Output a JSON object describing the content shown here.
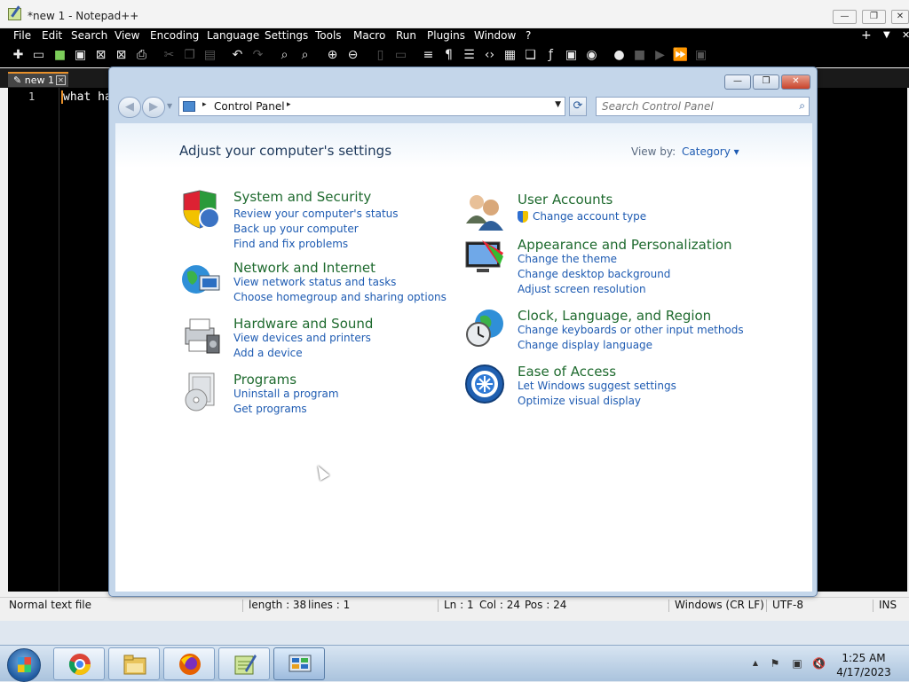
{
  "notepad": {
    "title": "*new 1 - Notepad++",
    "window_buttons": {
      "minimize": "—",
      "maximize": "❐",
      "close": "✕"
    },
    "menu": [
      "File",
      "Edit",
      "Search",
      "View",
      "Encoding",
      "Language",
      "Settings",
      "Tools",
      "Macro",
      "Run",
      "Plugins",
      "Window",
      "?"
    ],
    "menu_right": {
      "add": "+",
      "dropdown": "▼",
      "close": "✕"
    },
    "tab": {
      "label": "new 1",
      "close": "✕"
    },
    "editor": {
      "line_number": "1",
      "text": "what ha"
    },
    "status": {
      "file_type": "Normal text file",
      "length": "length : 38",
      "lines": "lines : 1",
      "ln": "Ln : 1",
      "col": "Col : 24",
      "pos": "Pos : 24",
      "eol": "Windows (CR LF)",
      "encoding": "UTF-8",
      "mode": "INS"
    }
  },
  "control_panel": {
    "window_buttons": {
      "minimize": "—",
      "maximize": "❐",
      "close": "✕"
    },
    "nav": {
      "back": "◀",
      "forward": "▶",
      "history": "▼"
    },
    "address": {
      "arrow": "▸",
      "location": "Control Panel",
      "arrow_after": "▸",
      "dropdown": "▼"
    },
    "refresh": "⟳",
    "search": {
      "placeholder": "Search Control Panel",
      "icon": "⌕"
    },
    "heading": "Adjust your computer's settings",
    "view_by": {
      "label": "View by:",
      "value": "Category ▾"
    },
    "categories_left": [
      {
        "title": "System and Security",
        "icon": "shield-icon",
        "links": [
          "Review your computer's status",
          "Back up your computer",
          "Find and fix problems"
        ]
      },
      {
        "title": "Network and Internet",
        "icon": "globe-network-icon",
        "links": [
          "View network status and tasks",
          "Choose homegroup and sharing options"
        ]
      },
      {
        "title": "Hardware and Sound",
        "icon": "printer-icon",
        "links": [
          "View devices and printers",
          "Add a device"
        ]
      },
      {
        "title": "Programs",
        "icon": "programs-icon",
        "links": [
          "Uninstall a program",
          "Get programs"
        ]
      }
    ],
    "categories_right": [
      {
        "title": "User Accounts",
        "icon": "users-icon",
        "links": [
          "Change account type"
        ]
      },
      {
        "title": "Appearance and Personalization",
        "icon": "display-icon",
        "links": [
          "Change the theme",
          "Change desktop background",
          "Adjust screen resolution"
        ]
      },
      {
        "title": "Clock, Language, and Region",
        "icon": "clock-globe-icon",
        "links": [
          "Change keyboards or other input methods",
          "Change display language"
        ]
      },
      {
        "title": "Ease of Access",
        "icon": "ease-of-access-icon",
        "links": [
          "Let Windows suggest settings",
          "Optimize visual display"
        ]
      }
    ]
  },
  "taskbar": {
    "apps": [
      {
        "name": "chrome-icon"
      },
      {
        "name": "file-explorer-icon"
      },
      {
        "name": "firefox-icon"
      },
      {
        "name": "notepad-plus-plus-icon"
      },
      {
        "name": "control-panel-icon"
      }
    ],
    "tray": {
      "chevron": "▲",
      "flag": "⚑",
      "network": "▣",
      "volume": "🔇"
    },
    "clock": {
      "time": "1:25 AM",
      "date": "4/17/2023"
    }
  },
  "colors": {
    "accent": "#1e5bb2",
    "category_title": "#1e6a2e",
    "npp_background": "#000000"
  }
}
